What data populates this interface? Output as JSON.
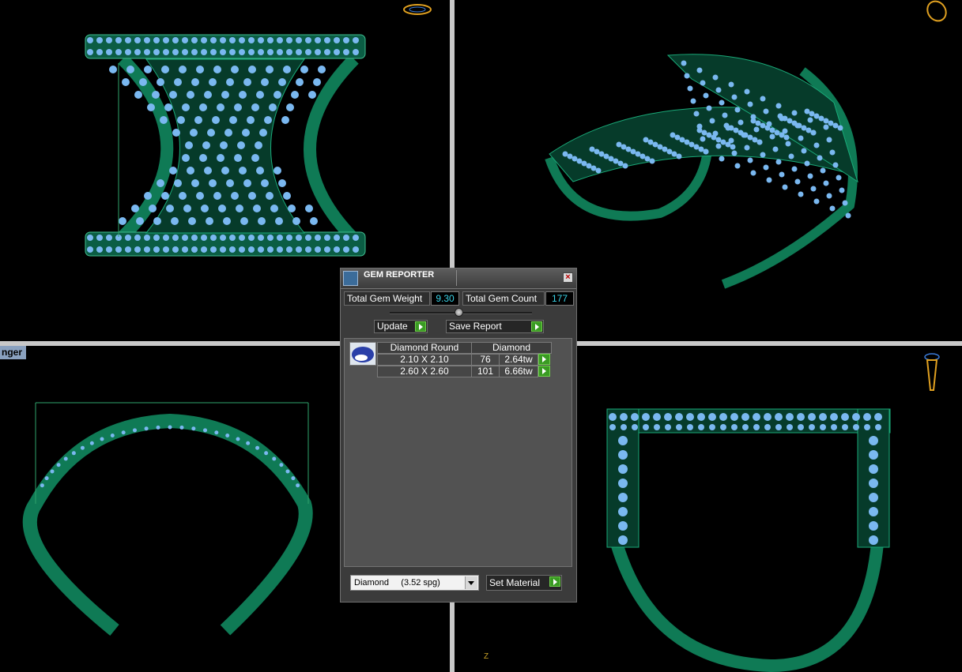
{
  "viewport_tag": "nger",
  "axis_label": "Z",
  "gem_reporter": {
    "title": "GEM REPORTER",
    "close_label": "×",
    "total_weight_label": "Total Gem Weight",
    "total_weight_value": "9.30",
    "total_count_label": "Total Gem Count",
    "total_count_value": "177",
    "update_label": "Update",
    "save_report_label": "Save Report",
    "table": {
      "shape_header": "Diamond Round",
      "material_header": "Diamond",
      "rows": [
        {
          "size": "2.10 X 2.10",
          "count": "76",
          "weight": "2.64tw"
        },
        {
          "size": "2.60 X 2.60",
          "count": "101",
          "weight": "6.66tw"
        }
      ]
    },
    "material_select": {
      "value": "Diamond     (3.52 spg)"
    },
    "set_material_label": "Set Material"
  },
  "colors": {
    "metal": "#0f7a55",
    "gem": "#7ab8f0",
    "divider": "#c8c8c8",
    "panel_bg": "#3b3b3b",
    "value_text": "#39d2e6",
    "button_green": "#3a9b23"
  },
  "icons": [
    "ring-gizmo-icon",
    "pendant-gizmo-icon",
    "gem-report-icon",
    "close-icon",
    "play-icon",
    "dropdown-arrow-icon",
    "round-gem-icon"
  ]
}
